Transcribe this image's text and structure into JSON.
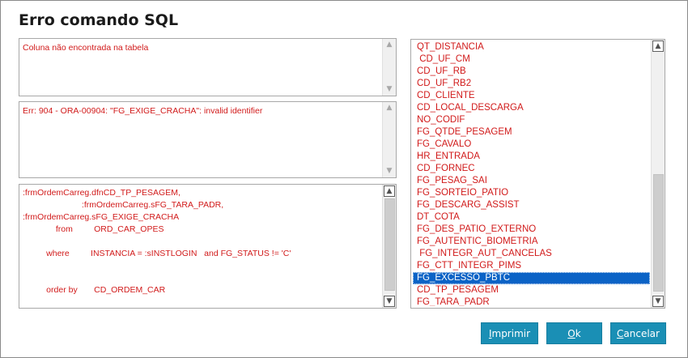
{
  "dialog": {
    "title": "Erro comando SQL"
  },
  "memo1": {
    "text": "Coluna não encontrada na tabela"
  },
  "memo2": {
    "text": "Err: 904 - ORA-00904: \"FG_EXIGE_CRACHA\": invalid identifier"
  },
  "memo3": {
    "text": ":frmOrdemCarreg.dfnCD_TP_PESAGEM,\n                         :frmOrdemCarreg.sFG_TARA_PADR,\n:frmOrdemCarreg.sFG_EXIGE_CRACHA\n              from         ORD_CAR_OPES\n\n          where         INSTANCIA = :sINSTLOGIN   and FG_STATUS != 'C'\n\n\n          order by       CD_ORDEM_CAR"
  },
  "field_list": {
    "items": [
      "QT_DISTANCIA",
      " CD_UF_CM",
      "CD_UF_RB",
      "CD_UF_RB2",
      "CD_CLIENTE",
      "CD_LOCAL_DESCARGA",
      "NO_CODIF",
      "FG_QTDE_PESAGEM",
      "FG_CAVALO",
      "HR_ENTRADA",
      "CD_FORNEC",
      "FG_PESAG_SAI",
      "FG_SORTEIO_PATIO",
      "FG_DESCARG_ASSIST",
      "DT_COTA",
      "FG_DES_PATIO_EXTERNO",
      "FG_AUTENTIC_BIOMETRIA",
      " FG_INTEGR_AUT_CANCELAS",
      "FG_CTT_INTEGR_PIMS",
      "FG_EXCESSO_PBTC",
      "CD_TP_PESAGEM",
      "FG_TARA_PADR"
    ],
    "selected_index": 19
  },
  "buttons": {
    "print": {
      "first": "I",
      "rest": "mprimir"
    },
    "ok": {
      "first": "O",
      "rest": "k"
    },
    "cancel": {
      "first": "C",
      "rest": "ancelar"
    }
  },
  "colors": {
    "text_red": "#d11a1a",
    "button_bg": "#1a8fb5",
    "selection": "#0b63c6"
  }
}
